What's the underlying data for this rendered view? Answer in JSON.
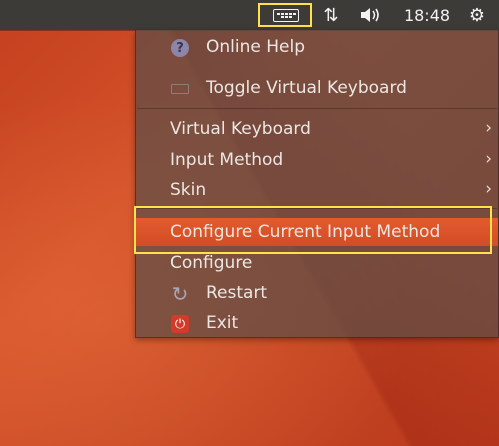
{
  "topbar": {
    "keyboard_indicator_icon": "keyboard-icon",
    "network_icon": "network-updown-icon",
    "network_glyph": "⇅",
    "sound_icon": "volume-icon",
    "sound_glyph": "🔊",
    "clock": "18:48",
    "settings_icon": "gear-icon",
    "settings_glyph": "⚙"
  },
  "menu": {
    "items": [
      {
        "label": "Online Help",
        "icon": "help-icon"
      },
      {
        "label": "Toggle Virtual Keyboard",
        "icon": "virtual-keyboard-icon"
      },
      {
        "label": "Virtual Keyboard",
        "submenu": true
      },
      {
        "label": "Input Method",
        "submenu": true
      },
      {
        "label": "Skin",
        "submenu": true
      },
      {
        "label": "Configure Current Input Method",
        "highlighted": true
      },
      {
        "label": "Configure"
      },
      {
        "label": "Restart",
        "icon": "restart-icon"
      },
      {
        "label": "Exit",
        "icon": "exit-icon"
      }
    ],
    "submenu_arrow": "›"
  },
  "colors": {
    "panel": "#3c3b37",
    "highlight_outline": "#ffe14b",
    "active_item": "#e35a2e",
    "wallpaper": "#d4522a"
  }
}
